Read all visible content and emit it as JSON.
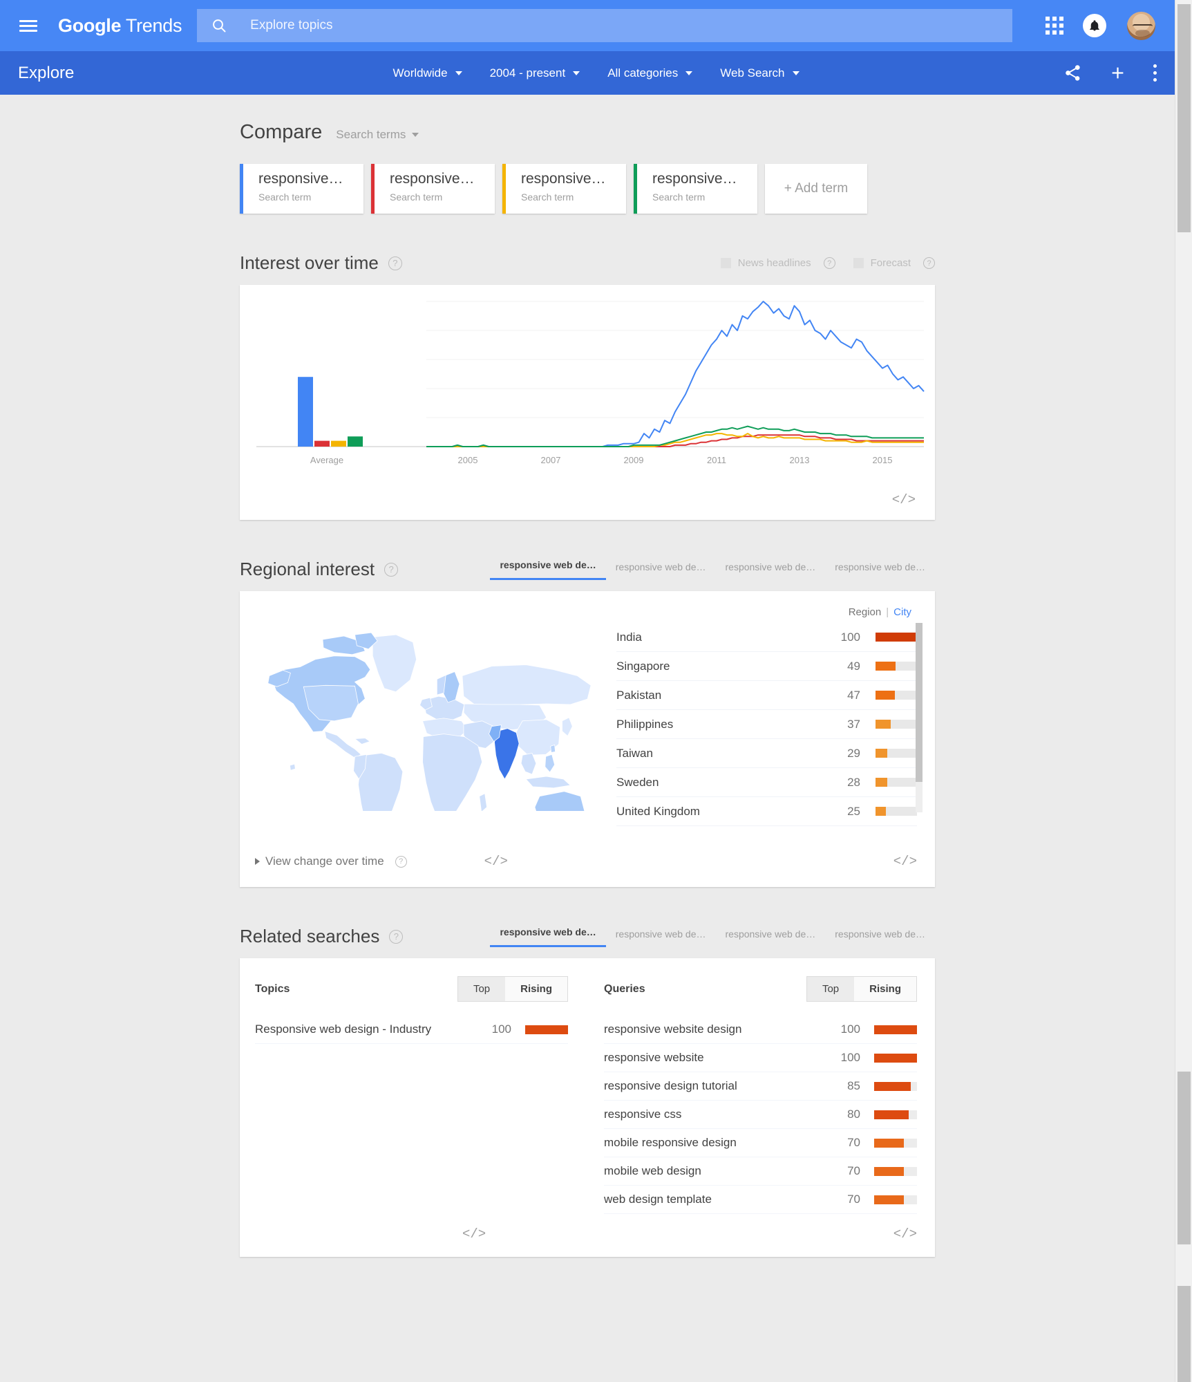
{
  "topbar": {
    "brand_google": "Google",
    "brand_trends": " Trends",
    "search_placeholder": "Explore topics",
    "menu_icon": "hamburger-icon",
    "search_icon": "search-icon",
    "apps_icon": "apps-grid-icon",
    "bell_icon": "notifications-bell-icon",
    "avatar_icon": "user-avatar"
  },
  "explorebar": {
    "title": "Explore",
    "filters": [
      {
        "label": "Worldwide",
        "name": "location-filter"
      },
      {
        "label": "2004 - present",
        "name": "time-range-filter"
      },
      {
        "label": "All categories",
        "name": "category-filter"
      },
      {
        "label": "Web Search",
        "name": "search-type-filter"
      }
    ],
    "share_icon": "share-icon",
    "add_icon": "plus-icon",
    "more_icon": "more-options-icon"
  },
  "compare": {
    "title": "Compare",
    "subtitle": "Search terms",
    "chips": [
      {
        "term": "responsive…",
        "label": "Search term",
        "color": "#4285f4"
      },
      {
        "term": "responsive…",
        "label": "Search term",
        "color": "#db3236"
      },
      {
        "term": "responsive…",
        "label": "Search term",
        "color": "#f4b400"
      },
      {
        "term": "responsive…",
        "label": "Search term",
        "color": "#0f9d58"
      }
    ],
    "add_term": "+ Add term"
  },
  "interest_over_time": {
    "title": "Interest over time",
    "help": "?",
    "news_headlines": "News headlines",
    "forecast": "Forecast",
    "embed": "</>"
  },
  "chart_data": {
    "type": "line",
    "title": "Interest over time",
    "xlabel": "",
    "ylabel": "",
    "ylim": [
      0,
      100
    ],
    "grid": true,
    "legend": "none",
    "average_label": "Average",
    "average_bars": [
      {
        "name": "responsive web design",
        "value": 48,
        "color": "#4285f4"
      },
      {
        "name": "responsive web de… (2)",
        "value": 4,
        "color": "#db3236"
      },
      {
        "name": "responsive web de… (3)",
        "value": 4,
        "color": "#f4b400"
      },
      {
        "name": "responsive web de… (4)",
        "value": 7,
        "color": "#0f9d58"
      }
    ],
    "xtick_labels": [
      "2005",
      "2007",
      "2009",
      "2011",
      "2013",
      "2015"
    ],
    "x_start_year": 2004,
    "x_end_year": 2016,
    "series": [
      {
        "name": "responsive web design",
        "color": "#4285f4",
        "values": [
          0,
          0,
          0,
          0,
          0,
          0,
          1,
          0,
          0,
          0,
          0,
          1,
          0,
          0,
          0,
          0,
          0,
          0,
          0,
          0,
          0,
          0,
          0,
          0,
          0,
          0,
          0,
          0,
          0,
          0,
          0,
          0,
          0,
          0,
          0,
          1,
          1,
          1,
          2,
          2,
          2,
          3,
          9,
          6,
          12,
          10,
          18,
          16,
          24,
          30,
          36,
          44,
          52,
          58,
          64,
          70,
          74,
          80,
          76,
          84,
          80,
          90,
          88,
          93,
          96,
          100,
          97,
          92,
          95,
          90,
          88,
          97,
          93,
          84,
          87,
          80,
          78,
          74,
          80,
          76,
          72,
          70,
          68,
          74,
          72,
          66,
          62,
          58,
          54,
          56,
          50,
          46,
          48,
          44,
          40,
          42,
          38
        ]
      },
      {
        "name": "responsive web de… (2)",
        "color": "#db3236",
        "values": [
          0,
          0,
          0,
          0,
          0,
          0,
          0,
          0,
          0,
          0,
          0,
          0,
          0,
          0,
          0,
          0,
          0,
          0,
          0,
          0,
          0,
          0,
          0,
          0,
          0,
          0,
          0,
          0,
          0,
          0,
          0,
          0,
          0,
          0,
          0,
          0,
          0,
          0,
          0,
          0,
          0,
          0,
          0,
          0,
          0,
          0,
          0,
          0,
          1,
          1,
          1,
          2,
          2,
          3,
          3,
          4,
          4,
          5,
          5,
          6,
          6,
          7,
          7,
          7,
          8,
          8,
          8,
          8,
          8,
          8,
          8,
          8,
          8,
          7,
          7,
          7,
          6,
          6,
          6,
          5,
          5,
          5,
          5,
          4,
          4,
          4,
          4,
          4,
          4,
          4,
          4,
          4,
          4,
          4,
          4,
          4,
          4
        ]
      },
      {
        "name": "responsive web de… (3)",
        "color": "#f4b400",
        "values": [
          0,
          0,
          0,
          0,
          0,
          0,
          0,
          0,
          0,
          0,
          0,
          0,
          0,
          0,
          0,
          0,
          0,
          0,
          0,
          0,
          0,
          0,
          0,
          0,
          0,
          0,
          0,
          0,
          0,
          0,
          0,
          0,
          0,
          0,
          0,
          0,
          0,
          0,
          0,
          0,
          0,
          0,
          0,
          0,
          0,
          1,
          1,
          2,
          3,
          3,
          4,
          5,
          6,
          7,
          8,
          8,
          9,
          9,
          8,
          8,
          7,
          7,
          9,
          7,
          6,
          7,
          6,
          6,
          7,
          6,
          6,
          6,
          6,
          5,
          5,
          5,
          5,
          4,
          4,
          4,
          4,
          4,
          3,
          3,
          3,
          4,
          3,
          3,
          3,
          3,
          3,
          3,
          3,
          3,
          3,
          3,
          3
        ]
      },
      {
        "name": "responsive web de… (4)",
        "color": "#0f9d58",
        "values": [
          0,
          0,
          0,
          0,
          0,
          0,
          1,
          0,
          0,
          0,
          0,
          1,
          0,
          0,
          0,
          0,
          0,
          0,
          0,
          0,
          0,
          0,
          0,
          0,
          0,
          0,
          0,
          0,
          0,
          0,
          0,
          0,
          0,
          0,
          0,
          0,
          0,
          0,
          0,
          0,
          1,
          1,
          1,
          1,
          1,
          1,
          2,
          3,
          4,
          5,
          6,
          7,
          8,
          9,
          10,
          10,
          11,
          12,
          12,
          13,
          12,
          13,
          14,
          13,
          12,
          13,
          12,
          12,
          12,
          11,
          11,
          12,
          11,
          10,
          10,
          10,
          9,
          9,
          9,
          8,
          8,
          8,
          7,
          7,
          7,
          7,
          6,
          6,
          6,
          6,
          6,
          6,
          6,
          6,
          6,
          6,
          6
        ]
      }
    ]
  },
  "regional_interest": {
    "title": "Regional interest",
    "help": "?",
    "tabs": [
      {
        "label": "responsive web de…",
        "active": true
      },
      {
        "label": "responsive web de…",
        "active": false
      },
      {
        "label": "responsive web de…",
        "active": false
      },
      {
        "label": "responsive web de…",
        "active": false
      }
    ],
    "toggle_region": "Region",
    "toggle_city": "City",
    "rows": [
      {
        "name": "India",
        "value": 100
      },
      {
        "name": "Singapore",
        "value": 49
      },
      {
        "name": "Pakistan",
        "value": 47
      },
      {
        "name": "Philippines",
        "value": 37
      },
      {
        "name": "Taiwan",
        "value": 29
      },
      {
        "name": "Sweden",
        "value": 28
      },
      {
        "name": "United Kingdom",
        "value": 25
      }
    ],
    "view_change": "View change over time",
    "embed_map": "</>",
    "embed_list": "</>",
    "map_name": "world-choropleth-map",
    "map_top_country": "India"
  },
  "related_searches": {
    "title": "Related searches",
    "help": "?",
    "tabs": [
      {
        "label": "responsive web de…",
        "active": true
      },
      {
        "label": "responsive web de…",
        "active": false
      },
      {
        "label": "responsive web de…",
        "active": false
      },
      {
        "label": "responsive web de…",
        "active": false
      }
    ],
    "topics": {
      "label": "Topics",
      "top": "Top",
      "rising": "Rising",
      "rows": [
        {
          "name": "Responsive web design - Industry",
          "value": 100
        }
      ],
      "embed": "</>"
    },
    "queries": {
      "label": "Queries",
      "top": "Top",
      "rising": "Rising",
      "rows": [
        {
          "name": "responsive website design",
          "value": 100
        },
        {
          "name": "responsive website",
          "value": 100
        },
        {
          "name": "responsive design tutorial",
          "value": 85
        },
        {
          "name": "responsive css",
          "value": 80
        },
        {
          "name": "mobile responsive design",
          "value": 70
        },
        {
          "name": "mobile web design",
          "value": 70
        },
        {
          "name": "web design template",
          "value": 70
        }
      ],
      "embed": "</>"
    }
  },
  "colors": {
    "topbar": "#4787f5",
    "explorebar": "#3367d6",
    "accent_blue": "#4285f4",
    "bar_orange": "#dd4b10",
    "page_bg": "#ebebeb"
  }
}
